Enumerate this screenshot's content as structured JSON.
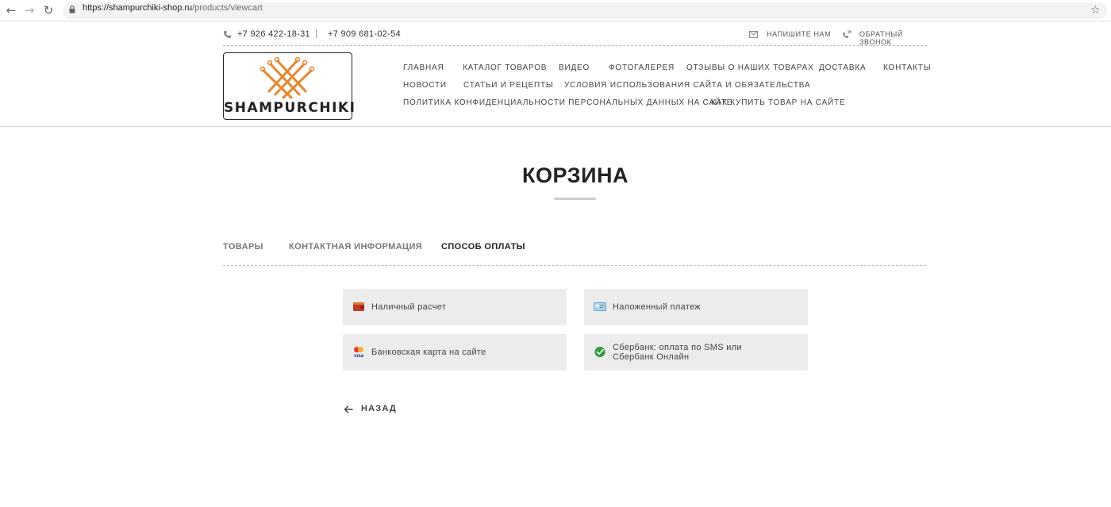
{
  "browser": {
    "url_domain": "https://shampurchiki-shop.ru",
    "url_path": "/products/viewcart"
  },
  "topbar": {
    "phone1": "+7 926 422-18-31",
    "phone2": "+7 909 681-02-54",
    "write_us": "НАПИШИТЕ НАМ",
    "callback": "ОБРАТНЫЙ ЗВОНОК"
  },
  "logo": {
    "text": "SHAMPURCHIKI",
    "color": "#e8862e"
  },
  "menu": [
    "ГЛАВНАЯ",
    "КАТАЛОГ ТОВАРОВ",
    "ВИДЕО",
    "ФОТОГАЛЕРЕЯ",
    "ОТЗЫВЫ О НАШИХ ТОВАРАХ",
    "ДОСТАВКА",
    "КОНТАКТЫ",
    "НОВОСТИ",
    "СТАТЬИ И РЕЦЕПТЫ",
    "УСЛОВИЯ ИСПОЛЬЗОВАНИЯ САЙТА И ОБЯЗАТЕЛЬСТВА",
    "ПОЛИТИКА КОНФИДЕНЦИАЛЬНОСТИ ПЕРСОНАЛЬНЫХ ДАННЫХ НА САЙТЕ",
    "КАК КУПИТЬ ТОВАР НА САЙТЕ"
  ],
  "page": {
    "title": "КОРЗИНА"
  },
  "tabs": [
    {
      "label": "ТОВАРЫ",
      "active": false
    },
    {
      "label": "КОНТАКТНАЯ ИНФОРМАЦИЯ",
      "active": false
    },
    {
      "label": "СПОСОБ ОПЛАТЫ",
      "active": true
    }
  ],
  "payment_methods": [
    {
      "icon": "wallet-icon",
      "label": "Наличный расчет"
    },
    {
      "icon": "card-icon",
      "label": "Наложенный платеж"
    },
    {
      "icon": "mastercard-visa-icon",
      "label": "Банковская карта на сайте"
    },
    {
      "icon": "sberbank-icon",
      "label_line1": "Сбербанк: оплата по SMS или",
      "label_line2": "Сбербанк Онлайн"
    }
  ],
  "back": {
    "label": "НАЗАД"
  }
}
